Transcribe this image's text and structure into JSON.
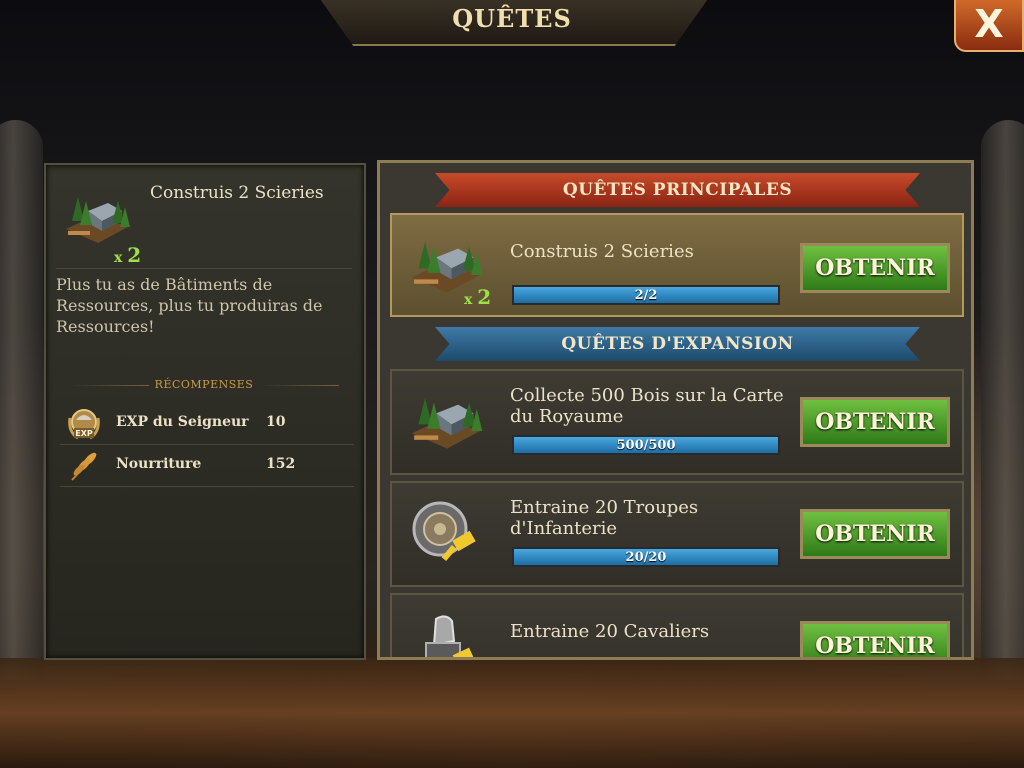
{
  "window": {
    "title": "QUÊTES",
    "close_label": "X"
  },
  "selected_quest": {
    "title": "Construis 2 Scieries",
    "multiplier": "2",
    "description": "Plus tu as de Bâtiments de Ressources, plus tu produiras de Ressources!",
    "rewards_heading": "RÉCOMPENSES",
    "rewards": [
      {
        "name": "EXP du Seigneur",
        "value": "10",
        "icon": "exp-icon"
      },
      {
        "name": "Nourriture",
        "value": "152",
        "icon": "wheat-icon"
      }
    ]
  },
  "sections": {
    "main_heading": "QUÊTES PRINCIPALES",
    "expansion_heading": "QUÊTES D'EXPANSION"
  },
  "quests": [
    {
      "title": "Construis 2 Scieries",
      "progress": "2/2",
      "fraction": 1.0,
      "button": "OBTENIR",
      "multiplier": "2",
      "icon": "sawmill-icon"
    },
    {
      "title": "Collecte 500 Bois sur la Carte du Royaume",
      "progress": "500/500",
      "fraction": 1.0,
      "button": "OBTENIR",
      "icon": "sawmill-icon"
    },
    {
      "title": "Entraine 20 Troupes d'Infanterie",
      "progress": "20/20",
      "fraction": 1.0,
      "button": "OBTENIR",
      "icon": "shield-icon"
    },
    {
      "title": "Entraine 20 Cavaliers",
      "button": "OBTENIR",
      "icon": "knight-icon"
    }
  ]
}
